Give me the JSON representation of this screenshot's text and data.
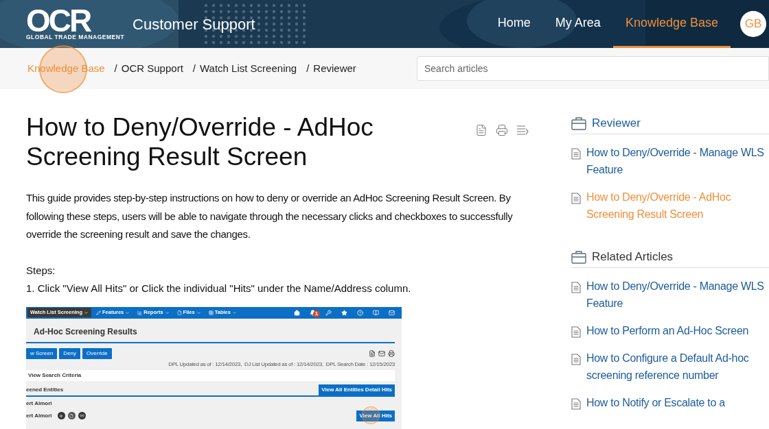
{
  "header": {
    "logo": {
      "wordmark": "OCR",
      "tagline": "GLOBAL TRADE MANAGEMENT"
    },
    "title": "Customer Support",
    "nav": [
      {
        "label": "Home",
        "selected": false
      },
      {
        "label": "My Area",
        "selected": false
      },
      {
        "label": "Knowledge Base",
        "selected": true
      }
    ],
    "avatar": "GB"
  },
  "breadcrumb": {
    "separator": "/",
    "items": [
      {
        "label": "Knowledge Base",
        "link": true
      },
      {
        "label": "OCR Support",
        "link": false
      },
      {
        "label": "Watch List Screening",
        "link": false
      },
      {
        "label": "Reviewer",
        "link": false
      }
    ]
  },
  "search": {
    "placeholder": "Search articles"
  },
  "article": {
    "title": "How to Deny/Override - AdHoc Screening Result Screen",
    "intro": "This guide provides step-by-step instructions on how to deny or override an AdHoc Screening Result Screen. By following these steps, users will be able to navigate through the necessary clicks and checkboxes to successfully override the screening result and save the changes.",
    "steps_heading": "Steps:",
    "steps": [
      "1. Click \"View All Hits\" or Click the individual \"Hits\" under the Name/Address column."
    ],
    "screenshot": {
      "menu": [
        {
          "label": "Watch List Screening",
          "selected": true,
          "kind": "none"
        },
        {
          "label": "Features",
          "selected": false,
          "kind": "pencil"
        },
        {
          "label": "Reports",
          "selected": false,
          "kind": "chart"
        },
        {
          "label": "Files",
          "selected": false,
          "kind": "file"
        },
        {
          "label": "Tables",
          "selected": false,
          "kind": "table"
        }
      ],
      "badge": "1",
      "title": "Ad-Hoc Screening Results",
      "buttons": [
        "w Screen",
        "Deny",
        "Override"
      ],
      "update_info": "DPL Updated as of : 12/14/2023,  DJ List Updated as of : 12/14/2023,  DPL Search Date : 12/15/2023",
      "criteria": "View Search Criteria",
      "section": "eened Entities",
      "section_button": "View All Entities Detail Hits",
      "group_label": "ert Almori",
      "row_name": "ert Almori",
      "row_button": "View All Hits"
    }
  },
  "sidebar": [
    {
      "title": "Reviewer",
      "articles": [
        {
          "title": "How to Deny/Override - Manage WLS Feature",
          "selected": false
        },
        {
          "title": "How to Deny/Override - AdHoc Screening Result Screen",
          "selected": true
        }
      ]
    },
    {
      "title": "Related Articles",
      "articles": [
        {
          "title": "How to Deny/Override - Manage WLS Feature",
          "selected": false
        },
        {
          "title": "How to Perform an Ad-Hoc Screen",
          "selected": false
        },
        {
          "title": "How to Configure a Default Ad-hoc screening reference number",
          "selected": false
        },
        {
          "title": "How to Notify or Escalate to a",
          "selected": false
        }
      ]
    }
  ]
}
